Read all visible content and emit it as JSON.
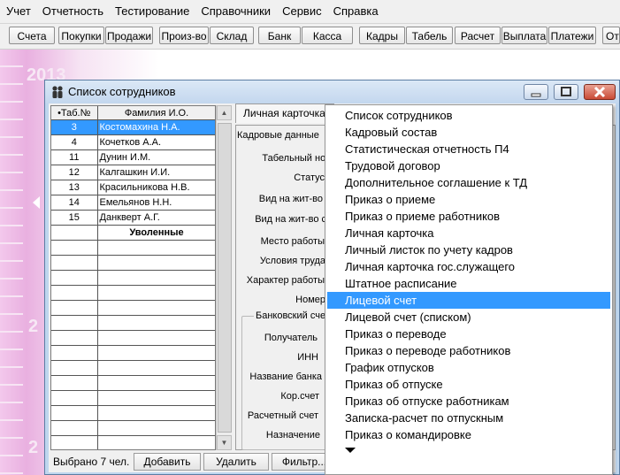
{
  "menubar": {
    "items": [
      "Учет",
      "Отчетность",
      "Тестирование",
      "Справочники",
      "Сервис",
      "Справка"
    ]
  },
  "toolbar": {
    "buttons": [
      "Счета",
      "Покупки",
      "Продажи",
      "Произ-во",
      "Склад",
      "Банк",
      "Касса",
      "Кадры",
      "Табель",
      "Расчет",
      "Выплата",
      "Платежи",
      "От"
    ]
  },
  "desktop": {
    "numbers": [
      "2013",
      "2",
      "2"
    ]
  },
  "window": {
    "title": "Список сотрудников"
  },
  "employee_table": {
    "columns": [
      "•Таб.№",
      "Фамилия И.О."
    ],
    "rows": [
      {
        "num": "3",
        "name": "Костомахина Н.А.",
        "selected": true
      },
      {
        "num": "4",
        "name": "Кочетков А.А.",
        "selected": false
      },
      {
        "num": "11",
        "name": "Дунин И.М.",
        "selected": false
      },
      {
        "num": "12",
        "name": "Калгашкин И.И.",
        "selected": false
      },
      {
        "num": "13",
        "name": "Красильникова Н.В.",
        "selected": false
      },
      {
        "num": "14",
        "name": "Емельянов Н.Н.",
        "selected": false
      },
      {
        "num": "15",
        "name": "Данкверт А.Г.",
        "selected": false
      }
    ],
    "section_label": "Уволенные"
  },
  "bottom": {
    "status": "Выбрано 7 чел.",
    "add": "Добавить",
    "delete": "Удалить",
    "filter": "Фильтр..."
  },
  "tabs": [
    "Личная карточка",
    "Кадровые данные"
  ],
  "form_labels": [
    "Табельный номер",
    "Статус",
    "Вид на жит-во",
    "Вид на жит-во с",
    "Место работы",
    "Условия труда",
    "Характер работы",
    "Номер"
  ],
  "bank_group": {
    "title": "Банковский сче",
    "labels": [
      "Получатель",
      "ИНН",
      "Название банка",
      "Кор.счет",
      "Расчетный счет",
      "Назначение"
    ]
  },
  "dropdown": {
    "items": [
      "Список сотрудников",
      "Кадровый состав",
      "Статистическая отчетность П4",
      "Трудовой договор",
      "Дополнительное соглашение к ТД",
      "Приказ о приеме",
      "Приказ о приеме работников",
      "Личная карточка",
      "Личный листок по учету кадров",
      "Личная карточка гос.служащего",
      "Штатное расписание",
      "Лицевой счет",
      "Лицевой счет (списком)",
      "Приказ о переводе",
      "Приказ о переводе работников",
      "График отпусков",
      "Приказ об отпуске",
      "Приказ об отпуске работникам",
      "Записка-расчет по отпускным",
      "Приказ о командировке"
    ],
    "selected_index": 11
  },
  "colors": {
    "selection": "#3399ff",
    "window_frame": "#bfd6ee",
    "desktop": "#e9b0e0"
  }
}
